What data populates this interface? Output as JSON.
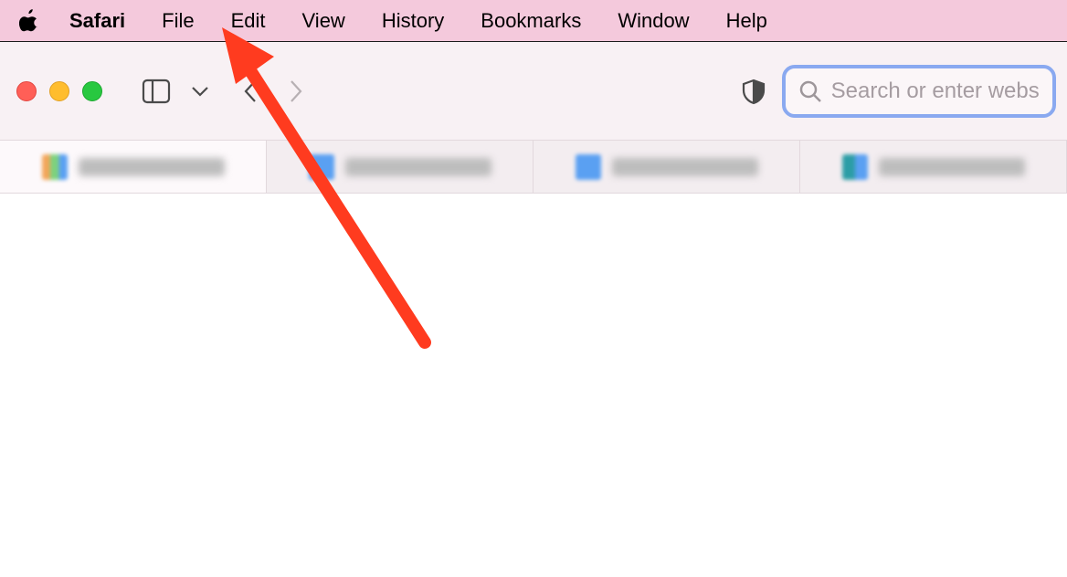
{
  "menubar": {
    "app_name": "Safari",
    "items": [
      "File",
      "Edit",
      "View",
      "History",
      "Bookmarks",
      "Window",
      "Help"
    ]
  },
  "toolbar": {
    "search_placeholder": "Search or enter website"
  },
  "tabs": [
    {
      "favicon_variant": "alt1",
      "title_obscured": true
    },
    {
      "favicon_variant": "default",
      "title_obscured": true
    },
    {
      "favicon_variant": "default",
      "title_obscured": true
    },
    {
      "favicon_variant": "alt4",
      "title_obscured": true
    }
  ],
  "annotation": {
    "type": "arrow",
    "color": "#ff3b1f",
    "points_to": "menu-item-file"
  }
}
